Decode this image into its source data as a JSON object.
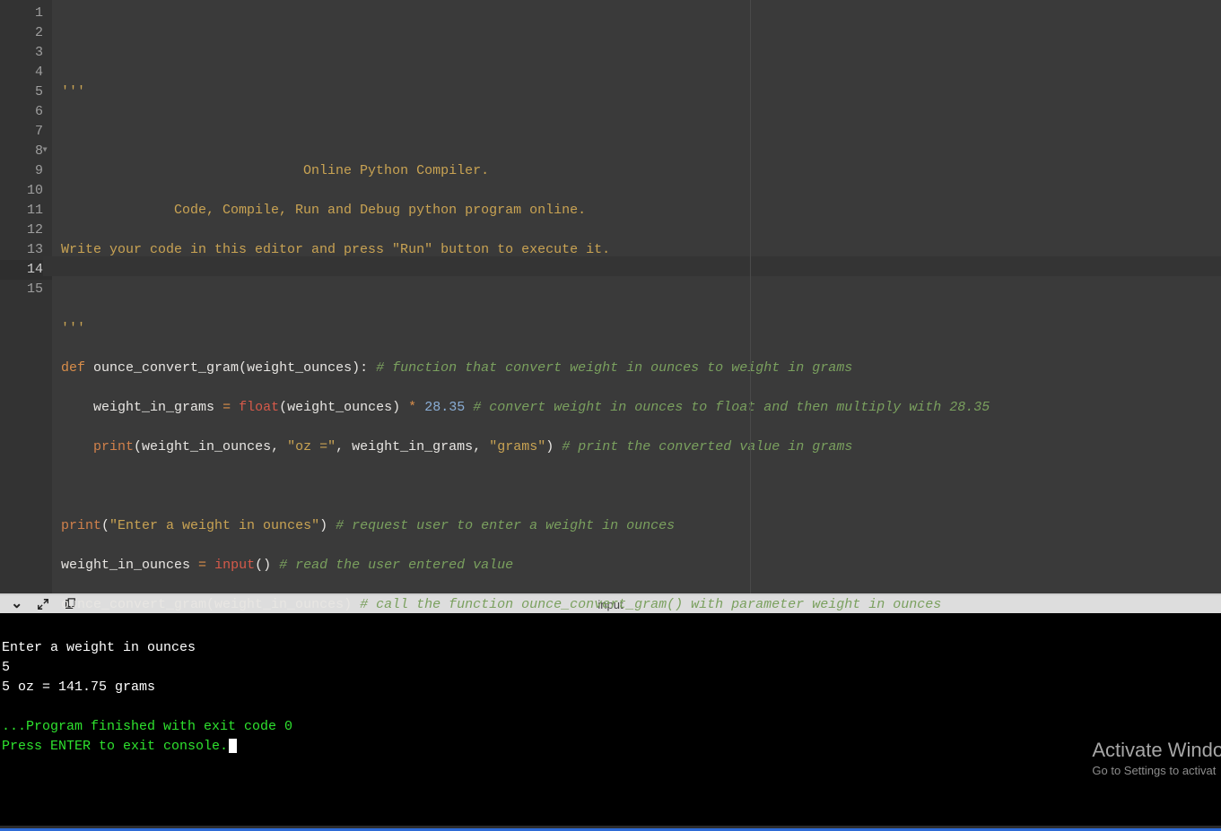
{
  "editor": {
    "line_count": 15,
    "active_line": 14,
    "lines": {
      "l1_str": "'''",
      "l3_text": "Online Python Compiler.",
      "l4_text": "Code, Compile, Run and Debug python program online.",
      "l5_text": "Write your code in this editor and press \"Run\" button to execute it.",
      "l7_str": "'''",
      "l8": {
        "kw_def": "def",
        "fn_name": "ounce_convert_gram",
        "params": "(weight_ounces)",
        "colon": ":",
        "comment": "# function that convert weight in ounces to weight in grams"
      },
      "l9": {
        "var": "weight_in_grams",
        "eq": "=",
        "float_fn": "float",
        "float_arg": "(weight_ounces)",
        "mul": "*",
        "num": "28.35",
        "comment": "# convert weight in ounces to float and then multiply with 28.35"
      },
      "l10": {
        "print_fn": "print",
        "open": "(",
        "arg1": "weight_in_ounces",
        "comma1": ",",
        "str1": "\"oz =\"",
        "comma2": ",",
        "arg2": "weight_in_grams",
        "comma3": ",",
        "str2": "\"grams\"",
        "close": ")",
        "comment": "# print the converted value in grams"
      },
      "l12": {
        "print_fn": "print",
        "open": "(",
        "str": "\"Enter a weight in ounces\"",
        "close": ")",
        "comment": "# request user to enter a weight in ounces"
      },
      "l13": {
        "var": "weight_in_ounces",
        "eq": "=",
        "input_fn": "input",
        "parens": "()",
        "comment": "# read the user entered value"
      },
      "l14": {
        "fn_name": "ounce_convert_gram",
        "open": "(",
        "arg": "weight_in_ounces",
        "close": ")",
        "comment": "# call the function ounce_convert_gram() with parameter weight in ounces"
      }
    }
  },
  "toolbar": {
    "input_label": "input"
  },
  "console": {
    "l1": "Enter a weight in ounces",
    "l2": "5",
    "l3": "5 oz = 141.75 grams",
    "l5": "...Program finished with exit code 0",
    "l6": "Press ENTER to exit console."
  },
  "watermark": {
    "title": "Activate Windows",
    "sub": "Go to Settings to activat"
  }
}
